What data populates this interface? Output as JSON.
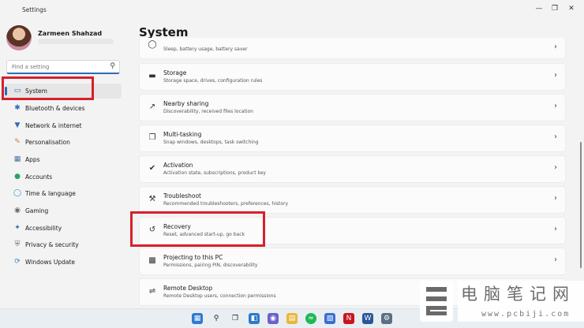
{
  "window": {
    "title": "Settings",
    "min_icon": "minimize-icon",
    "max_icon": "maximize-icon",
    "close_icon": "close-icon"
  },
  "profile": {
    "name": "Zarmeen Shahzad"
  },
  "search": {
    "placeholder": "Find a setting"
  },
  "sidebar": {
    "items": [
      {
        "label": "System",
        "icon": "monitor-icon",
        "active": true
      },
      {
        "label": "Bluetooth & devices",
        "icon": "bluetooth-icon"
      },
      {
        "label": "Network & internet",
        "icon": "wifi-icon"
      },
      {
        "label": "Personalisation",
        "icon": "brush-icon"
      },
      {
        "label": "Apps",
        "icon": "apps-icon"
      },
      {
        "label": "Accounts",
        "icon": "person-icon"
      },
      {
        "label": "Time & language",
        "icon": "globe-icon"
      },
      {
        "label": "Gaming",
        "icon": "gamepad-icon"
      },
      {
        "label": "Accessibility",
        "icon": "accessibility-icon"
      },
      {
        "label": "Privacy & security",
        "icon": "shield-icon"
      },
      {
        "label": "Windows Update",
        "icon": "update-icon"
      }
    ]
  },
  "main": {
    "title": "System",
    "cards": [
      {
        "title": "",
        "subtitle": "Sleep, battery usage, battery saver",
        "icon": "power-icon"
      },
      {
        "title": "Storage",
        "subtitle": "Storage space, drives, configuration rules",
        "icon": "storage-icon"
      },
      {
        "title": "Nearby sharing",
        "subtitle": "Discoverability, received files location",
        "icon": "share-icon"
      },
      {
        "title": "Multi-tasking",
        "subtitle": "Snap windows, desktops, task switching",
        "icon": "multitask-icon"
      },
      {
        "title": "Activation",
        "subtitle": "Activation state, subscriptions, product key",
        "icon": "check-circle-icon"
      },
      {
        "title": "Troubleshoot",
        "subtitle": "Recommended troubleshooters, preferences, history",
        "icon": "wrench-icon"
      },
      {
        "title": "Recovery",
        "subtitle": "Reset, advanced start-up, go back",
        "icon": "recovery-icon"
      },
      {
        "title": "Projecting to this PC",
        "subtitle": "Permissions, pairing PIN, discoverability",
        "icon": "projector-icon"
      },
      {
        "title": "Remote Desktop",
        "subtitle": "Remote Desktop users, connection permissions",
        "icon": "remote-icon"
      }
    ]
  },
  "taskbar": {
    "icons": [
      "windows-start-icon",
      "search-icon",
      "task-view-icon",
      "widgets-icon",
      "chat-icon",
      "file-explorer-icon",
      "spotify-icon",
      "store-icon",
      "netflix-icon",
      "word-icon",
      "settings-icon"
    ]
  },
  "watermark": {
    "text": "电脑笔记网",
    "url": "www.pcbiji.com"
  },
  "colors": {
    "accent": "#2e6bb8",
    "highlight": "#d8202a",
    "background": "#f3f3f3"
  }
}
